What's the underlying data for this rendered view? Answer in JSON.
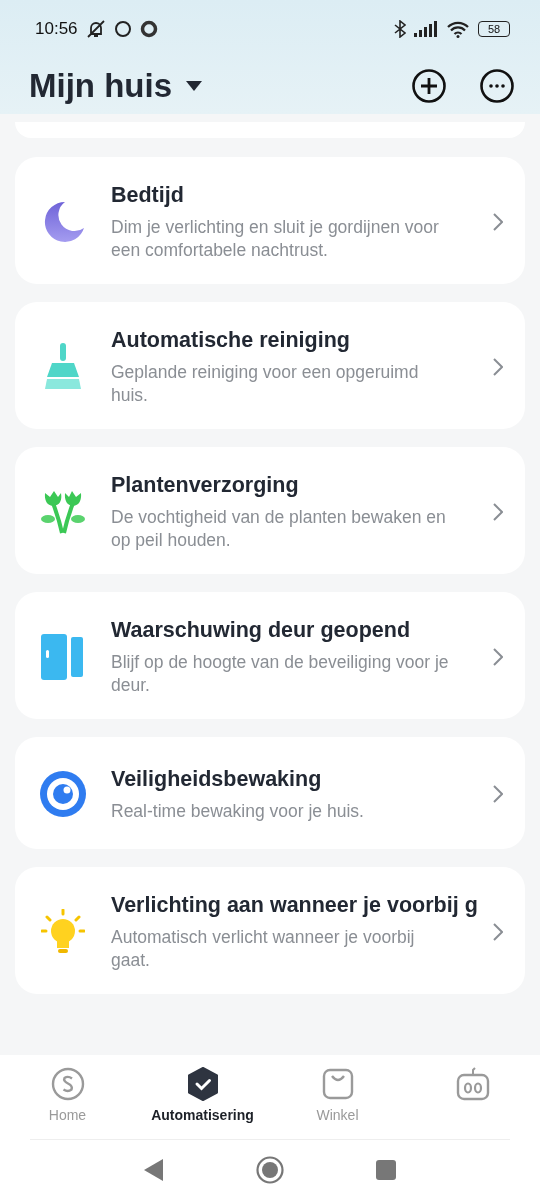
{
  "status_bar": {
    "time": "10:56",
    "battery": "58"
  },
  "header": {
    "title": "Mijn huis"
  },
  "scenes": [
    {
      "title": "Bedtijd",
      "description": "Dim je verlichting en sluit je gordijnen voor een comfortabele nachtrust."
    },
    {
      "title": "Automatische reiniging",
      "description": "Geplande reiniging voor een opgeruimd huis."
    },
    {
      "title": "Plantenverzorging",
      "description": "De vochtigheid van de planten bewaken en op peil houden."
    },
    {
      "title": "Waarschuwing deur geopend",
      "description": "Blijf op de hoogte van de beveiliging voor je deur."
    },
    {
      "title": "Veiligheidsbewaking",
      "description": "Real-time bewaking voor je huis."
    },
    {
      "title": "Verlichting aan wanneer je voorbij g",
      "description": "Automatisch verlicht wanneer je voorbij gaat."
    }
  ],
  "tabs": [
    {
      "label": "Home",
      "selected": false
    },
    {
      "label": "Automatisering",
      "selected": true
    },
    {
      "label": "Winkel",
      "selected": false
    },
    {
      "selected": false
    }
  ]
}
